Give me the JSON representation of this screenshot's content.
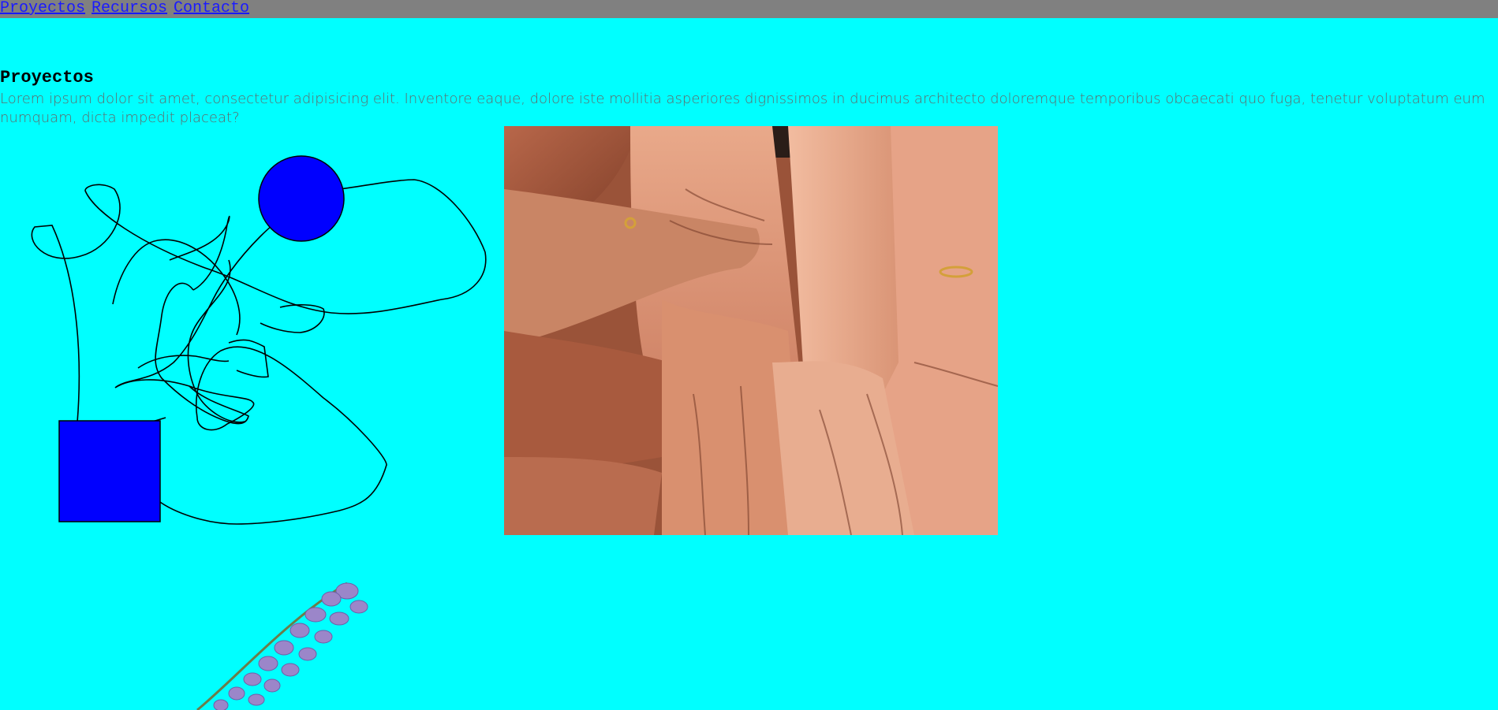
{
  "nav": {
    "items": [
      {
        "label": "Proyectos"
      },
      {
        "label": "Recursos"
      },
      {
        "label": "Contacto"
      }
    ]
  },
  "main": {
    "title": "Proyectos",
    "description": "Lorem ipsum dolor sit amet, consectetur adipisicing elit. Inventore eaque, dolore iste mollitia asperiores dignissimos in ducimus architecto doloremque temporibus obcaecati quo fuga, tenetur voluptatum eum numquam, dicta impedit placeat?"
  },
  "colors": {
    "background": "#00ffff",
    "nav_background": "#808080",
    "link": "#1a1aff",
    "shape_fill": "#0000ff"
  },
  "images": {
    "drawing": "scribble-with-circle-and-square",
    "photo": "stacked-hands-photo",
    "flower": "lavender-sprig"
  }
}
